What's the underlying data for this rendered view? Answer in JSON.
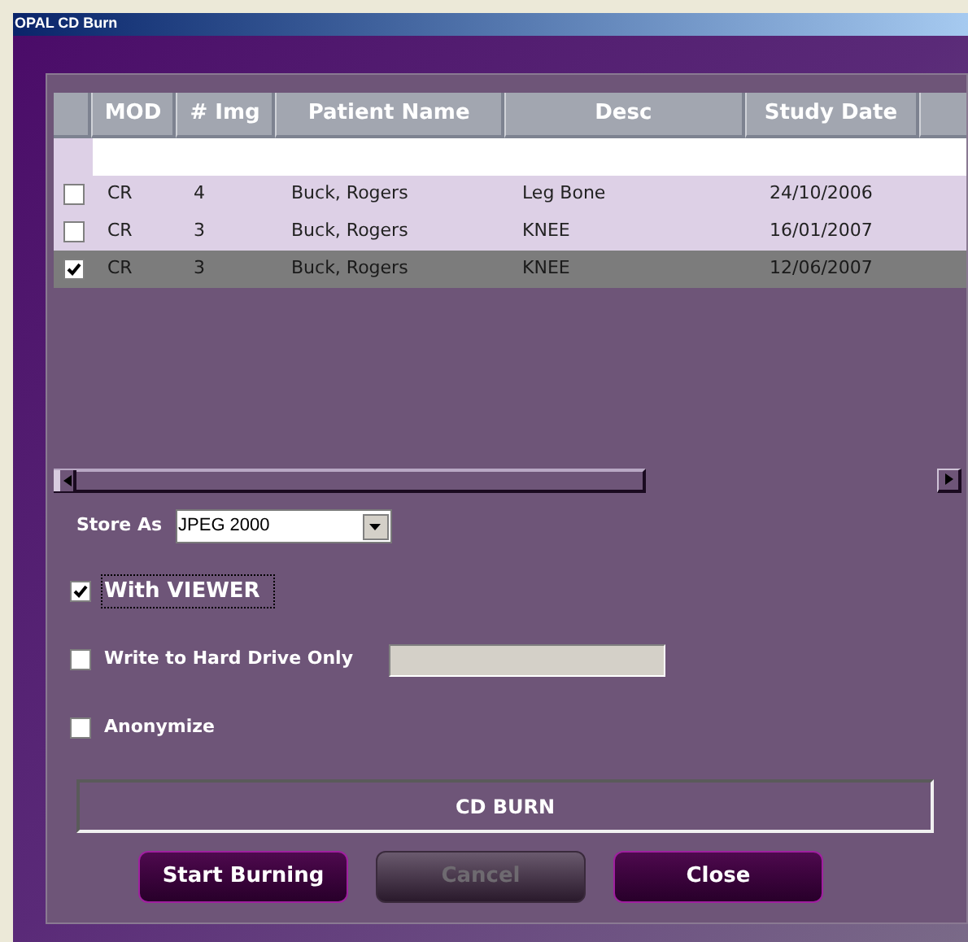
{
  "window": {
    "title": "OPAL CD Burn"
  },
  "table": {
    "columns": [
      "MOD",
      "# Img",
      "Patient Name",
      "Desc",
      "Study Date"
    ],
    "rows": [
      {
        "checked": false,
        "selected": false,
        "cells": [
          "CR",
          "4",
          "Buck, Rogers",
          "Leg Bone",
          "24/10/2006"
        ]
      },
      {
        "checked": false,
        "selected": false,
        "cells": [
          "CR",
          "3",
          "Buck, Rogers",
          "KNEE",
          "16/01/2007"
        ]
      },
      {
        "checked": true,
        "selected": true,
        "cells": [
          "CR",
          "3",
          "Buck, Rogers",
          "KNEE",
          "12/06/2007"
        ]
      }
    ]
  },
  "store_as": {
    "label": "Store As",
    "value": "JPEG 2000"
  },
  "options": [
    {
      "kind": "checkbox",
      "label": "With VIEWER",
      "checked": true,
      "focused": true
    },
    {
      "kind": "checkbox_field",
      "label": "Write to Hard Drive Only",
      "checked": false,
      "focused": false
    },
    {
      "kind": "checkbox",
      "label": "Anonymize",
      "checked": false,
      "focused": false
    }
  ],
  "status": "CD BURN",
  "buttons": [
    {
      "label": "Start Burning",
      "disabled": false
    },
    {
      "label": "Cancel",
      "disabled": true
    },
    {
      "label": "Close",
      "disabled": false
    }
  ]
}
